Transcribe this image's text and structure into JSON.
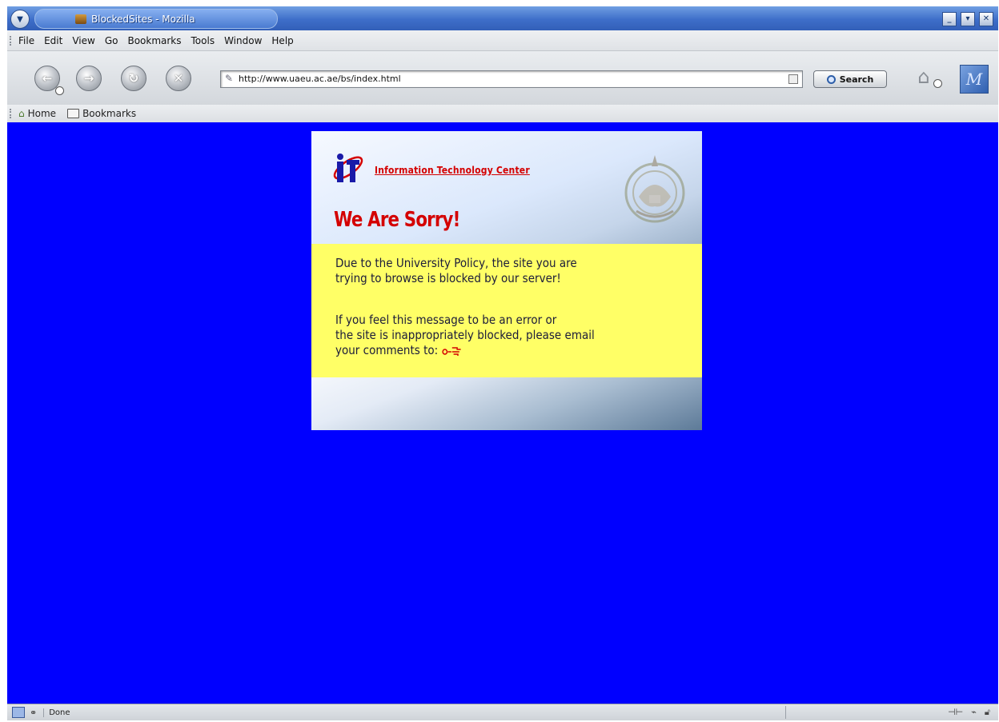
{
  "window": {
    "title": "BlockedSites - Mozilla",
    "controls": [
      "minimize",
      "maximize",
      "close"
    ]
  },
  "menubar": {
    "items": [
      "File",
      "Edit",
      "View",
      "Go",
      "Bookmarks",
      "Tools",
      "Window",
      "Help"
    ]
  },
  "navbar": {
    "buttons": [
      "back-icon",
      "forward-icon",
      "reload-icon",
      "stop-icon"
    ],
    "url": "http://www.uaeu.ac.ae/bs/index.html",
    "search_label": "Search"
  },
  "bookmarks_bar": {
    "home_label": "Home",
    "bookmarks_label": "Bookmarks"
  },
  "page": {
    "background_color": "#0000ff",
    "header_link": "Information Technology Center",
    "heading": "We Are Sorry!",
    "message_line1": "Due to the University Policy, the site you are",
    "message_line2": "trying to browse is blocked by our server!",
    "message_line3": "If you feel this message to be an error or",
    "message_line4": "the site is inappropriately blocked, please email",
    "message_line5": "your comments to:",
    "colors": {
      "heading": "#d40000",
      "message_box": "#ffff66"
    }
  },
  "statusbar": {
    "status": "Done"
  }
}
